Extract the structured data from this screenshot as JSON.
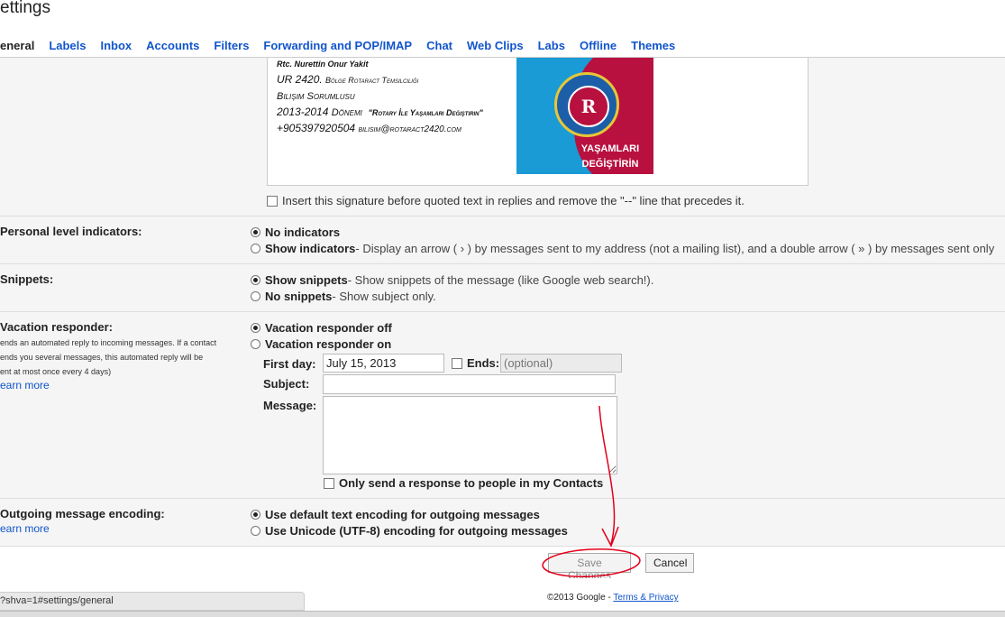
{
  "page": {
    "title": "ettings"
  },
  "tabs": [
    {
      "label": "eneral"
    },
    {
      "label": "Labels"
    },
    {
      "label": "Inbox"
    },
    {
      "label": "Accounts"
    },
    {
      "label": "Filters"
    },
    {
      "label": "Forwarding and POP/IMAP"
    },
    {
      "label": "Chat"
    },
    {
      "label": "Web Clips"
    },
    {
      "label": "Labs"
    },
    {
      "label": "Offline"
    },
    {
      "label": "Themes"
    }
  ],
  "signature": {
    "name_line": "Rtc. Nurettin Onur Yakit",
    "line2_prefix": "UR 2420.",
    "line2_small": "Bölge Rotaract Temsilciliği",
    "line3": "Bilişim Sorumlusu",
    "line4_prefix": "2013-2014",
    "line4_small": "Dönemi",
    "line4_quote": "\"Rotary İle Yaşamları Değiştirin\"",
    "line5_phone": "+905397920504",
    "line5_email": "bilisim@rotaract2420.com",
    "logo": {
      "ring_text": "ROTARACT CLUB",
      "letter": "R",
      "line1": "YAŞAMLARI",
      "line2": "DEĞİŞTİRİN"
    },
    "insert_before_quoted": "Insert this signature before quoted text in replies and remove the \"--\" line that precedes it."
  },
  "personal_level": {
    "label": "Personal level indicators:",
    "opt1": "No indicators",
    "opt2": "Show indicators",
    "opt2_desc": " - Display an arrow ( › ) by messages sent to my address (not a mailing list), and a double arrow ( » ) by messages sent only"
  },
  "snippets": {
    "label": "Snippets:",
    "opt1": "Show snippets",
    "opt1_desc": " - Show snippets of the message (like Google web search!).",
    "opt2": "No snippets",
    "opt2_desc": " - Show subject only."
  },
  "vacation": {
    "label": "Vacation responder:",
    "sub1": "ends an automated reply to incoming messages. If a contact",
    "sub2": "ends you several messages, this automated reply will be",
    "sub3": "ent at most once every 4 days)",
    "learn_more": "earn more",
    "off": "Vacation responder off",
    "on": "Vacation responder on",
    "first_day_label": "First day:",
    "first_day_value": "July 15, 2013",
    "ends_label": "Ends:",
    "ends_placeholder": "(optional)",
    "subject_label": "Subject:",
    "message_label": "Message:",
    "contacts_only": "Only send a response to people in my Contacts"
  },
  "encoding": {
    "label": "Outgoing message encoding:",
    "learn_more": "earn more",
    "opt1": "Use default text encoding for outgoing messages",
    "opt2": "Use Unicode (UTF-8) encoding for outgoing messages"
  },
  "actions": {
    "save": "Save Changes",
    "cancel": "Cancel"
  },
  "footer": {
    "copyright": "©2013 Google - ",
    "terms": "Terms & Privacy",
    "status_url": "?shva=1#settings/general"
  },
  "annotation_color": "#e3001b"
}
